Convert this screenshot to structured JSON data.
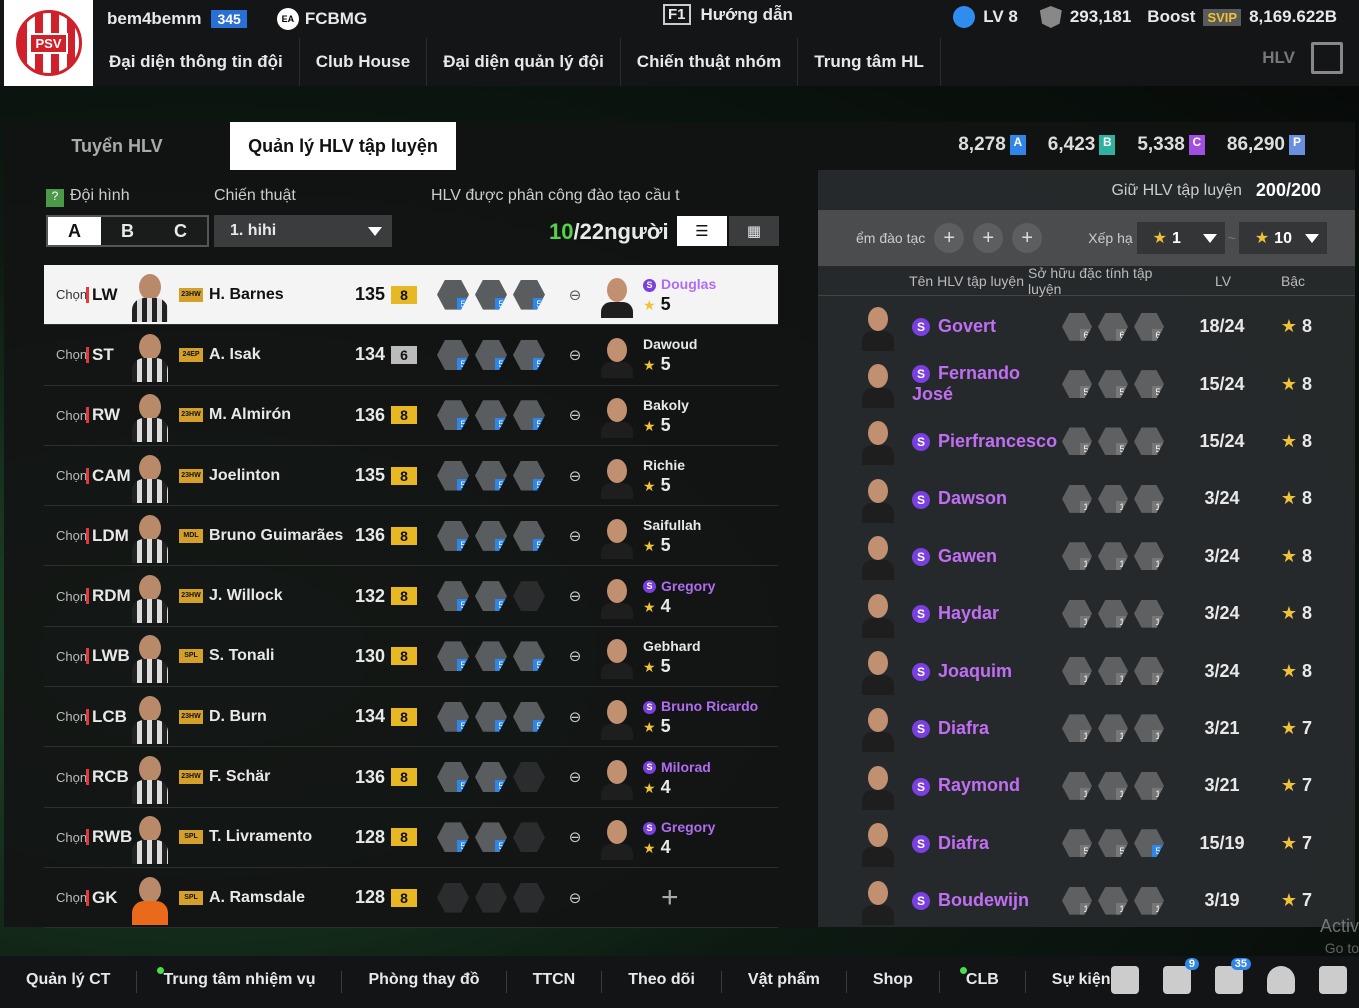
{
  "header": {
    "username": "bem4bemm",
    "user_level": "345",
    "club": "FCBMG",
    "ea_icon": "EA",
    "guide_key": "F1",
    "guide_label": "Hướng dẫn",
    "lv": "LV 8",
    "coins": "293,181",
    "boost": "Boost",
    "svip": "SVIP",
    "bp": "8,169.622B",
    "logo_text": "PSV",
    "hlv_label": "HLV"
  },
  "nav": [
    "Đại diện thông tin đội",
    "Club House",
    "Đại diện quản lý đội",
    "Chiến thuật nhóm",
    "Trung tâm HL"
  ],
  "tabs": [
    "Tuyển HLV",
    "Quản lý HLV tập luyện"
  ],
  "currencies": [
    {
      "value": "8,278",
      "badge": "A",
      "color": "#2f86e6"
    },
    {
      "value": "6,423",
      "badge": "B",
      "color": "#2fb0a0"
    },
    {
      "value": "5,338",
      "badge": "C",
      "color": "#a04fe0"
    },
    {
      "value": "86,290",
      "badge": "P",
      "color": "#6a8fe0"
    }
  ],
  "left": {
    "help": "?",
    "squad_label": "Đội hình",
    "tactic_label": "Chiến thuật",
    "assigned_label": "HLV được phân công đào tạo cầu t",
    "squads": [
      "A",
      "B",
      "C"
    ],
    "tactic_value": "1. hihi",
    "count_now": "10",
    "count_total": "/22người",
    "list_icon": "☰",
    "grid_icon": "▦"
  },
  "players": [
    {
      "chon": "Chọn",
      "pos": "LW",
      "season": "23HW",
      "name": "H. Barnes",
      "ovr": "135",
      "grade": "8",
      "skills": [
        "5",
        "5",
        "5"
      ],
      "coach": "Douglas",
      "special": true,
      "stars": "5"
    },
    {
      "chon": "Chọn",
      "pos": "ST",
      "season": "24EP",
      "name": "A. Isak",
      "ovr": "134",
      "grade": "6",
      "skills": [
        "5",
        "5",
        "5"
      ],
      "coach": "Dawoud",
      "special": false,
      "stars": "5"
    },
    {
      "chon": "Chọn",
      "pos": "RW",
      "season": "23HW",
      "name": "M. Almirón",
      "ovr": "136",
      "grade": "8",
      "skills": [
        "5",
        "5",
        "5"
      ],
      "coach": "Bakoly",
      "special": false,
      "stars": "5"
    },
    {
      "chon": "Chọn",
      "pos": "CAM",
      "season": "23HW",
      "name": "Joelinton",
      "ovr": "135",
      "grade": "8",
      "skills": [
        "5",
        "5",
        "5"
      ],
      "coach": "Richie",
      "special": false,
      "stars": "5"
    },
    {
      "chon": "Chọn",
      "pos": "LDM",
      "season": "MDL",
      "name": "Bruno Guimarães",
      "ovr": "136",
      "grade": "8",
      "skills": [
        "5",
        "5",
        "5"
      ],
      "coach": "Saifullah",
      "special": false,
      "stars": "5"
    },
    {
      "chon": "Chọn",
      "pos": "RDM",
      "season": "23HW",
      "name": "J. Willock",
      "ovr": "132",
      "grade": "8",
      "skills": [
        "5",
        "5",
        ""
      ],
      "coach": "Gregory",
      "special": true,
      "stars": "4"
    },
    {
      "chon": "Chọn",
      "pos": "LWB",
      "season": "SPL",
      "name": "S. Tonali",
      "ovr": "130",
      "grade": "8",
      "skills": [
        "5",
        "5",
        "5"
      ],
      "coach": "Gebhard",
      "special": false,
      "stars": "5"
    },
    {
      "chon": "Chọn",
      "pos": "LCB",
      "season": "23HW",
      "name": "D. Burn",
      "ovr": "134",
      "grade": "8",
      "skills": [
        "5",
        "5",
        "5"
      ],
      "coach": "Bruno Ricardo",
      "special": true,
      "stars": "5"
    },
    {
      "chon": "Chọn",
      "pos": "RCB",
      "season": "23HW",
      "name": "F. Schär",
      "ovr": "136",
      "grade": "8",
      "skills": [
        "5",
        "5",
        ""
      ],
      "coach": "Milorad",
      "special": true,
      "stars": "4"
    },
    {
      "chon": "Chọn",
      "pos": "RWB",
      "season": "SPL",
      "name": "T. Livramento",
      "ovr": "128",
      "grade": "8",
      "skills": [
        "5",
        "5",
        ""
      ],
      "coach": "Gregory",
      "special": true,
      "stars": "4"
    },
    {
      "chon": "Chọn",
      "pos": "GK",
      "season": "SPL",
      "name": "A. Ramsdale",
      "ovr": "128",
      "grade": "8",
      "skills": [
        "",
        "",
        ""
      ],
      "coach": "",
      "special": false,
      "stars": ""
    }
  ],
  "right": {
    "hold_label": "Giữ HLV tập luyện",
    "hold_value": "200/200",
    "train_label": "ểm đào tạc",
    "rank_label": "Xếp hạ",
    "rank_from": "1",
    "rank_to": "10",
    "tilde": "~",
    "col_name": "Tên HLV tập luyện",
    "col_trait": "Sở hữu đặc tính tập luyện",
    "col_lv": "LV",
    "col_grade": "Bậc"
  },
  "coaches": [
    {
      "name": "Govert",
      "traits": [
        "6",
        "6",
        "6"
      ],
      "lv": "18/24",
      "grade": "8"
    },
    {
      "name": "Fernando José",
      "traits": [
        "5",
        "5",
        "5"
      ],
      "lv": "15/24",
      "grade": "8"
    },
    {
      "name": "Pierfrancesco",
      "traits": [
        "5",
        "5",
        "5"
      ],
      "lv": "15/24",
      "grade": "8"
    },
    {
      "name": "Dawson",
      "traits": [
        "1",
        "1",
        "1"
      ],
      "lv": "3/24",
      "grade": "8"
    },
    {
      "name": "Gawen",
      "traits": [
        "1",
        "1",
        "1"
      ],
      "lv": "3/24",
      "grade": "8"
    },
    {
      "name": "Haydar",
      "traits": [
        "1",
        "1",
        "1"
      ],
      "lv": "3/24",
      "grade": "8"
    },
    {
      "name": "Joaquim",
      "traits": [
        "1",
        "1",
        "1"
      ],
      "lv": "3/24",
      "grade": "8"
    },
    {
      "name": "Diafra",
      "traits": [
        "1",
        "1",
        "1"
      ],
      "lv": "3/21",
      "grade": "7"
    },
    {
      "name": "Raymond",
      "traits": [
        "1",
        "1",
        "1"
      ],
      "lv": "3/21",
      "grade": "7"
    },
    {
      "name": "Diafra",
      "traits": [
        "5",
        "5",
        "5"
      ],
      "lv": "15/19",
      "grade": "7"
    },
    {
      "name": "Boudewijn",
      "traits": [
        "1",
        "1",
        "1"
      ],
      "lv": "3/19",
      "grade": "7"
    }
  ],
  "bottom": [
    {
      "label": "Quản lý CT",
      "dot": false
    },
    {
      "label": "Trung tâm nhiệm vụ",
      "dot": true
    },
    {
      "label": "Phòng thay đồ",
      "dot": false
    },
    {
      "label": "TTCN",
      "dot": false
    },
    {
      "label": "Theo dõi",
      "dot": false
    },
    {
      "label": "Vật phẩm",
      "dot": false
    },
    {
      "label": "Shop",
      "dot": false
    },
    {
      "label": "CLB",
      "dot": true
    },
    {
      "label": "Sự kiện",
      "dot": false
    }
  ],
  "bottom_icons": [
    {
      "name": "chat-icon",
      "badge": ""
    },
    {
      "name": "home-icon",
      "badge": "9"
    },
    {
      "name": "bell-icon",
      "badge": "35"
    },
    {
      "name": "profile-icon",
      "badge": ""
    },
    {
      "name": "settings-icon",
      "badge": ""
    }
  ],
  "watermark": {
    "line1": "Activ",
    "line2": "Go to"
  }
}
